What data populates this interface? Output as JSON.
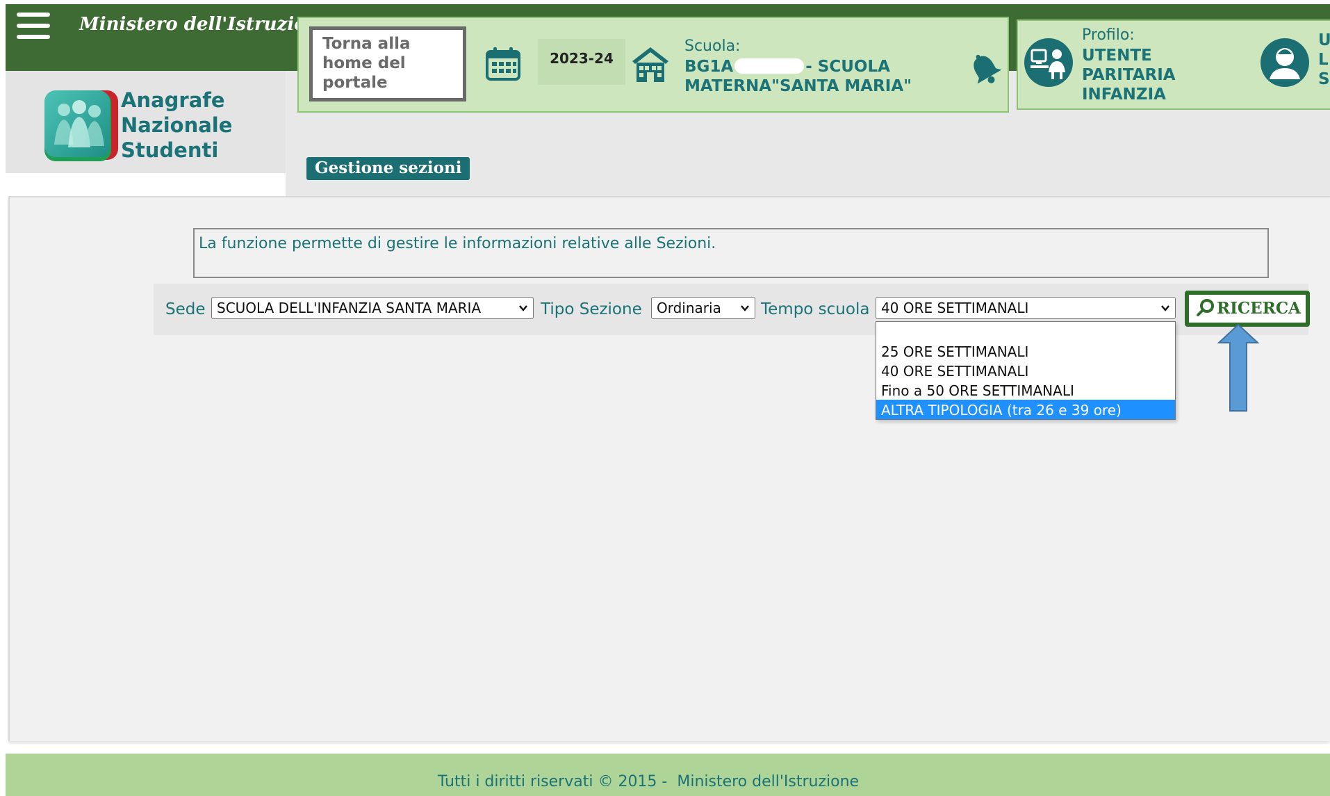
{
  "header": {
    "ministry_title": "Ministero dell'Istruzione",
    "menu_icon": "hamburger-menu-icon",
    "colors": {
      "header_green": "#3d6b33",
      "panel_green": "#cde6bd",
      "teal_text": "#1b7377"
    }
  },
  "logo": {
    "line1": "Anagrafe",
    "line2": "Nazionale",
    "line3": "Studenti"
  },
  "info_bar": {
    "home_button_line1": "Torna alla",
    "home_button_line2": "home del",
    "home_button_line3": "portale",
    "calendar_icon": "calendar-icon",
    "school_year": "2023-24",
    "school_icon": "school-building-icon",
    "scuola_label": "Scuola:",
    "scuola_code_prefix": "BG1A",
    "scuola_code_suffix": "- SCUOLA MATERNA\"SANTA MARIA\"",
    "bell_icon": "bell-icon",
    "profile_icon": "profile-desk-icon",
    "profilo_label": "Profilo:",
    "profilo_value": "UTENTE PARITARIA INFANZIA",
    "user_icon": "user-avatar-icon",
    "user_line1": "U",
    "user_line2": "L",
    "user_line3": "S"
  },
  "page": {
    "section_title": "Gestione sezioni",
    "description": "La funzione permette di gestire le informazioni relative alle Sezioni."
  },
  "form": {
    "sede_label": "Sede",
    "sede_value": "SCUOLA DELL'INFANZIA SANTA MARIA",
    "tipo_label": "Tipo Sezione",
    "tipo_value": "Ordinaria",
    "tempo_label": "Tempo scuola",
    "tempo_value": "40 ORE SETTIMANALI",
    "tempo_options": [
      "",
      "25 ORE SETTIMANALI",
      "40 ORE SETTIMANALI",
      "Fino a 50 ORE SETTIMANALI",
      "ALTRA TIPOLOGIA (tra 26 e 39 ore)"
    ],
    "highlighted_option": "ALTRA TIPOLOGIA (tra 26 e 39 ore)",
    "search_button": "RICERCA",
    "search_icon": "magnifier-icon"
  },
  "annotation": {
    "arrow_icon": "blue-up-arrow-icon",
    "arrow_color": "#5b9bd5"
  },
  "footer": {
    "text": "Tutti i diritti riservati © 2015 -  Ministero dell'Istruzione"
  }
}
